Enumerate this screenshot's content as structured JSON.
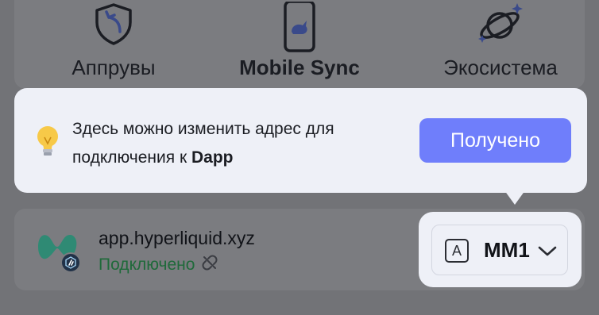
{
  "actions": [
    {
      "label": "Аппрувы",
      "icon": "shield-arrow-icon"
    },
    {
      "label": "Mobile Sync",
      "icon": "mobile-rabbit-icon"
    },
    {
      "label": "Экосистема",
      "icon": "planet-icon"
    }
  ],
  "tooltip": {
    "line1": "Здесь можно изменить адрес для",
    "line2_prefix": "подключения к ",
    "line2_bold": "Dapp",
    "button_label": "Получено",
    "icon": "lightbulb-icon"
  },
  "dapp": {
    "url": "app.hyperliquid.xyz",
    "status": "Подключено",
    "status_color": "#1f6a3a",
    "logo_icon": "hyperliquid-logo-icon",
    "chain_icon": "arbitrum-icon",
    "status_icon": "disconnect-link-icon"
  },
  "account": {
    "letter": "A",
    "name": "MM1",
    "icon": "chevron-down-icon"
  },
  "colors": {
    "accent": "#6f7efb",
    "card_bg": "#eef0f7",
    "overlay_bg": "#727377"
  }
}
